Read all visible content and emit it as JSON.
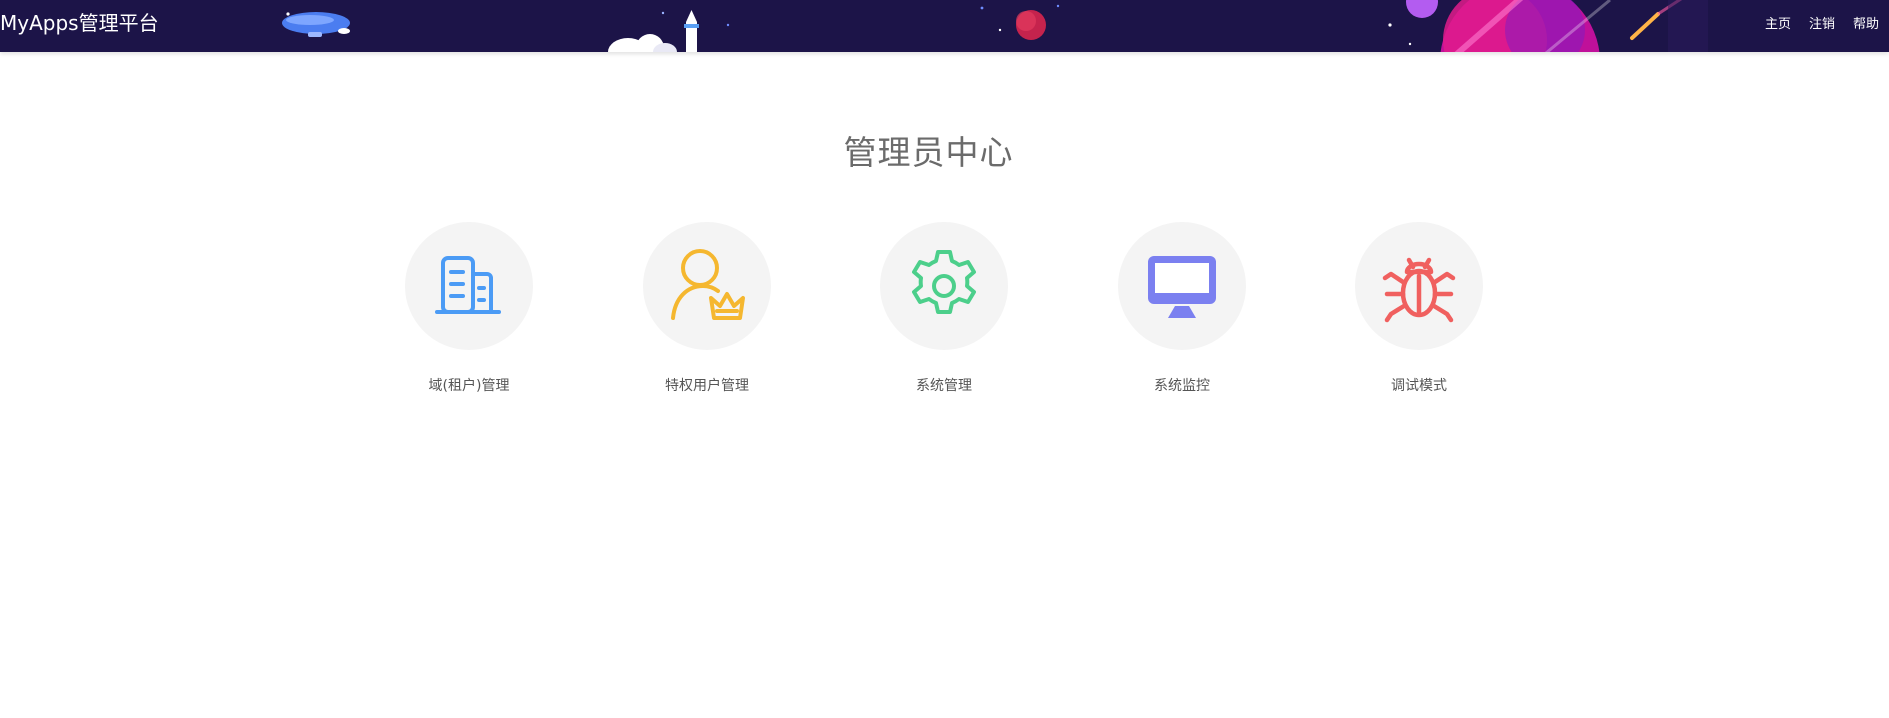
{
  "header": {
    "brand": "MyApps管理平台",
    "nav": [
      {
        "label": "主页"
      },
      {
        "label": "注销"
      },
      {
        "label": "帮助"
      }
    ],
    "background_color": "#1c1448"
  },
  "main": {
    "title": "管理员中心",
    "tiles": [
      {
        "label": "域(租户)管理",
        "icon": "building-icon",
        "color": "#4b9bf5"
      },
      {
        "label": "特权用户管理",
        "icon": "user-crown-icon",
        "color": "#f5b72f"
      },
      {
        "label": "系统管理",
        "icon": "gear-icon",
        "color": "#4ccf8b"
      },
      {
        "label": "系统监控",
        "icon": "monitor-icon",
        "color": "#7b80f0"
      },
      {
        "label": "调试模式",
        "icon": "bug-icon",
        "color": "#f0605f"
      }
    ]
  }
}
